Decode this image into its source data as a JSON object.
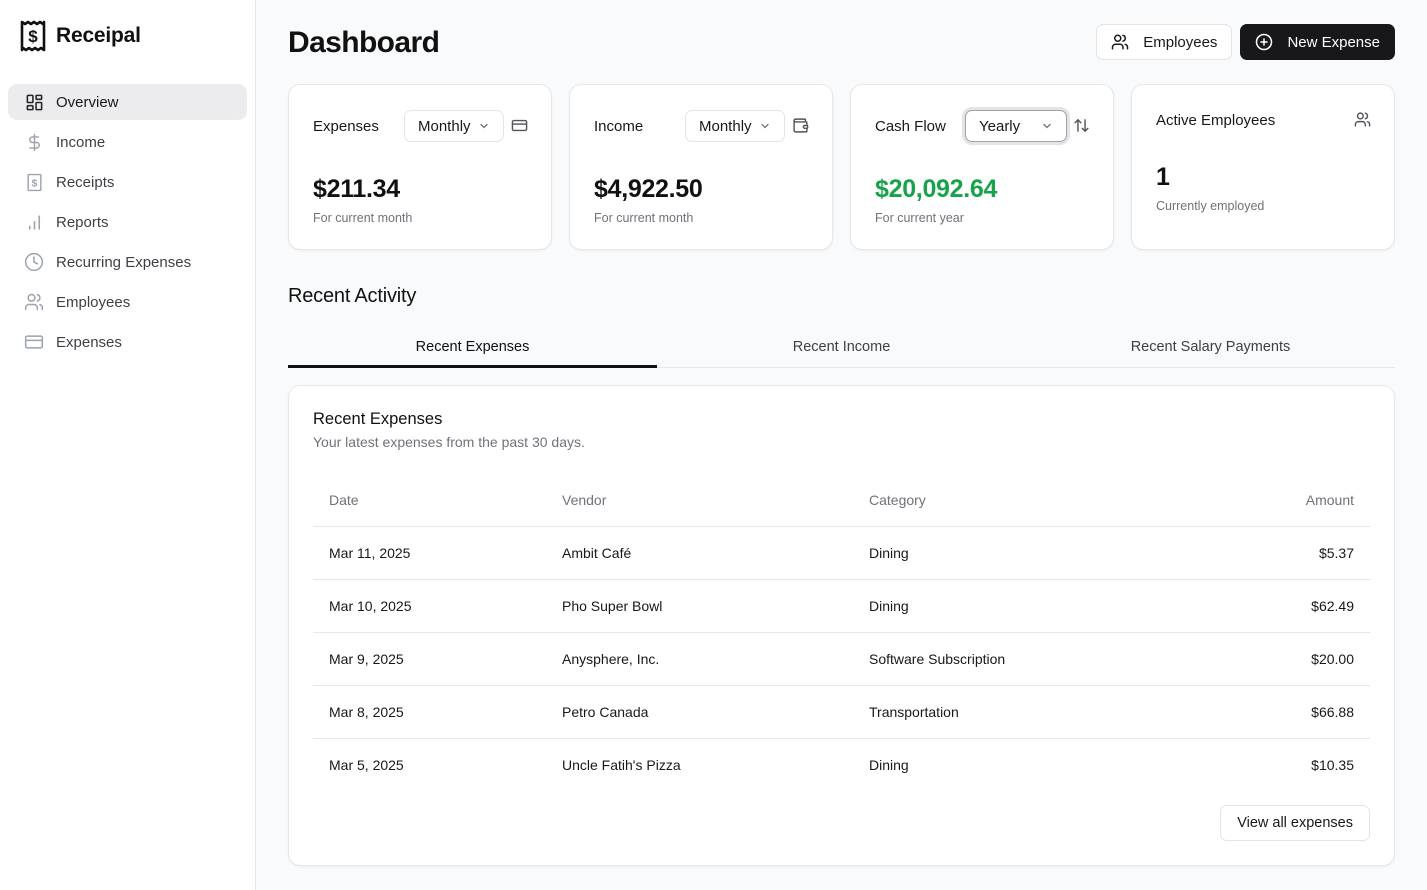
{
  "app": {
    "name": "Receipal"
  },
  "sidebar": {
    "items": [
      {
        "label": "Overview",
        "icon": "layout-dashboard-icon",
        "active": true
      },
      {
        "label": "Income",
        "icon": "dollar-sign-icon",
        "active": false
      },
      {
        "label": "Receipts",
        "icon": "receipt-icon",
        "active": false
      },
      {
        "label": "Reports",
        "icon": "bar-chart-icon",
        "active": false
      },
      {
        "label": "Recurring Expenses",
        "icon": "clock-icon",
        "active": false
      },
      {
        "label": "Employees",
        "icon": "users-icon",
        "active": false
      },
      {
        "label": "Expenses",
        "icon": "credit-card-icon",
        "active": false
      }
    ]
  },
  "header": {
    "title": "Dashboard",
    "employees_button": "Employees",
    "new_expense_button": "New Expense"
  },
  "cards": {
    "expenses": {
      "title": "Expenses",
      "period": "Monthly",
      "value": "$211.34",
      "subtitle": "For current month",
      "icon": "credit-card-icon"
    },
    "income": {
      "title": "Income",
      "period": "Monthly",
      "value": "$4,922.50",
      "subtitle": "For current month",
      "icon": "wallet-icon"
    },
    "cash_flow": {
      "title": "Cash Flow",
      "period": "Yearly",
      "value": "$20,092.64",
      "subtitle": "For current year",
      "icon": "arrow-up-down-icon",
      "value_color": "#16a34a"
    },
    "active_employees": {
      "title": "Active Employees",
      "value": "1",
      "subtitle": "Currently employed",
      "icon": "users-icon"
    }
  },
  "recent_activity": {
    "title": "Recent Activity",
    "tabs": [
      {
        "label": "Recent Expenses",
        "active": true
      },
      {
        "label": "Recent Income",
        "active": false
      },
      {
        "label": "Recent Salary Payments",
        "active": false
      }
    ],
    "panel": {
      "title": "Recent Expenses",
      "description": "Your latest expenses from the past 30 days.",
      "columns": [
        "Date",
        "Vendor",
        "Category",
        "Amount"
      ],
      "rows": [
        {
          "date": "Mar 11, 2025",
          "vendor": "Ambit Café",
          "category": "Dining",
          "amount": "$5.37"
        },
        {
          "date": "Mar 10, 2025",
          "vendor": "Pho Super Bowl",
          "category": "Dining",
          "amount": "$62.49"
        },
        {
          "date": "Mar 9, 2025",
          "vendor": "Anysphere, Inc.",
          "category": "Software Subscription",
          "amount": "$20.00"
        },
        {
          "date": "Mar 8, 2025",
          "vendor": "Petro Canada",
          "category": "Transportation",
          "amount": "$66.88"
        },
        {
          "date": "Mar 5, 2025",
          "vendor": "Uncle Fatih's Pizza",
          "category": "Dining",
          "amount": "$10.35"
        }
      ],
      "view_all_button": "View all expenses"
    }
  }
}
